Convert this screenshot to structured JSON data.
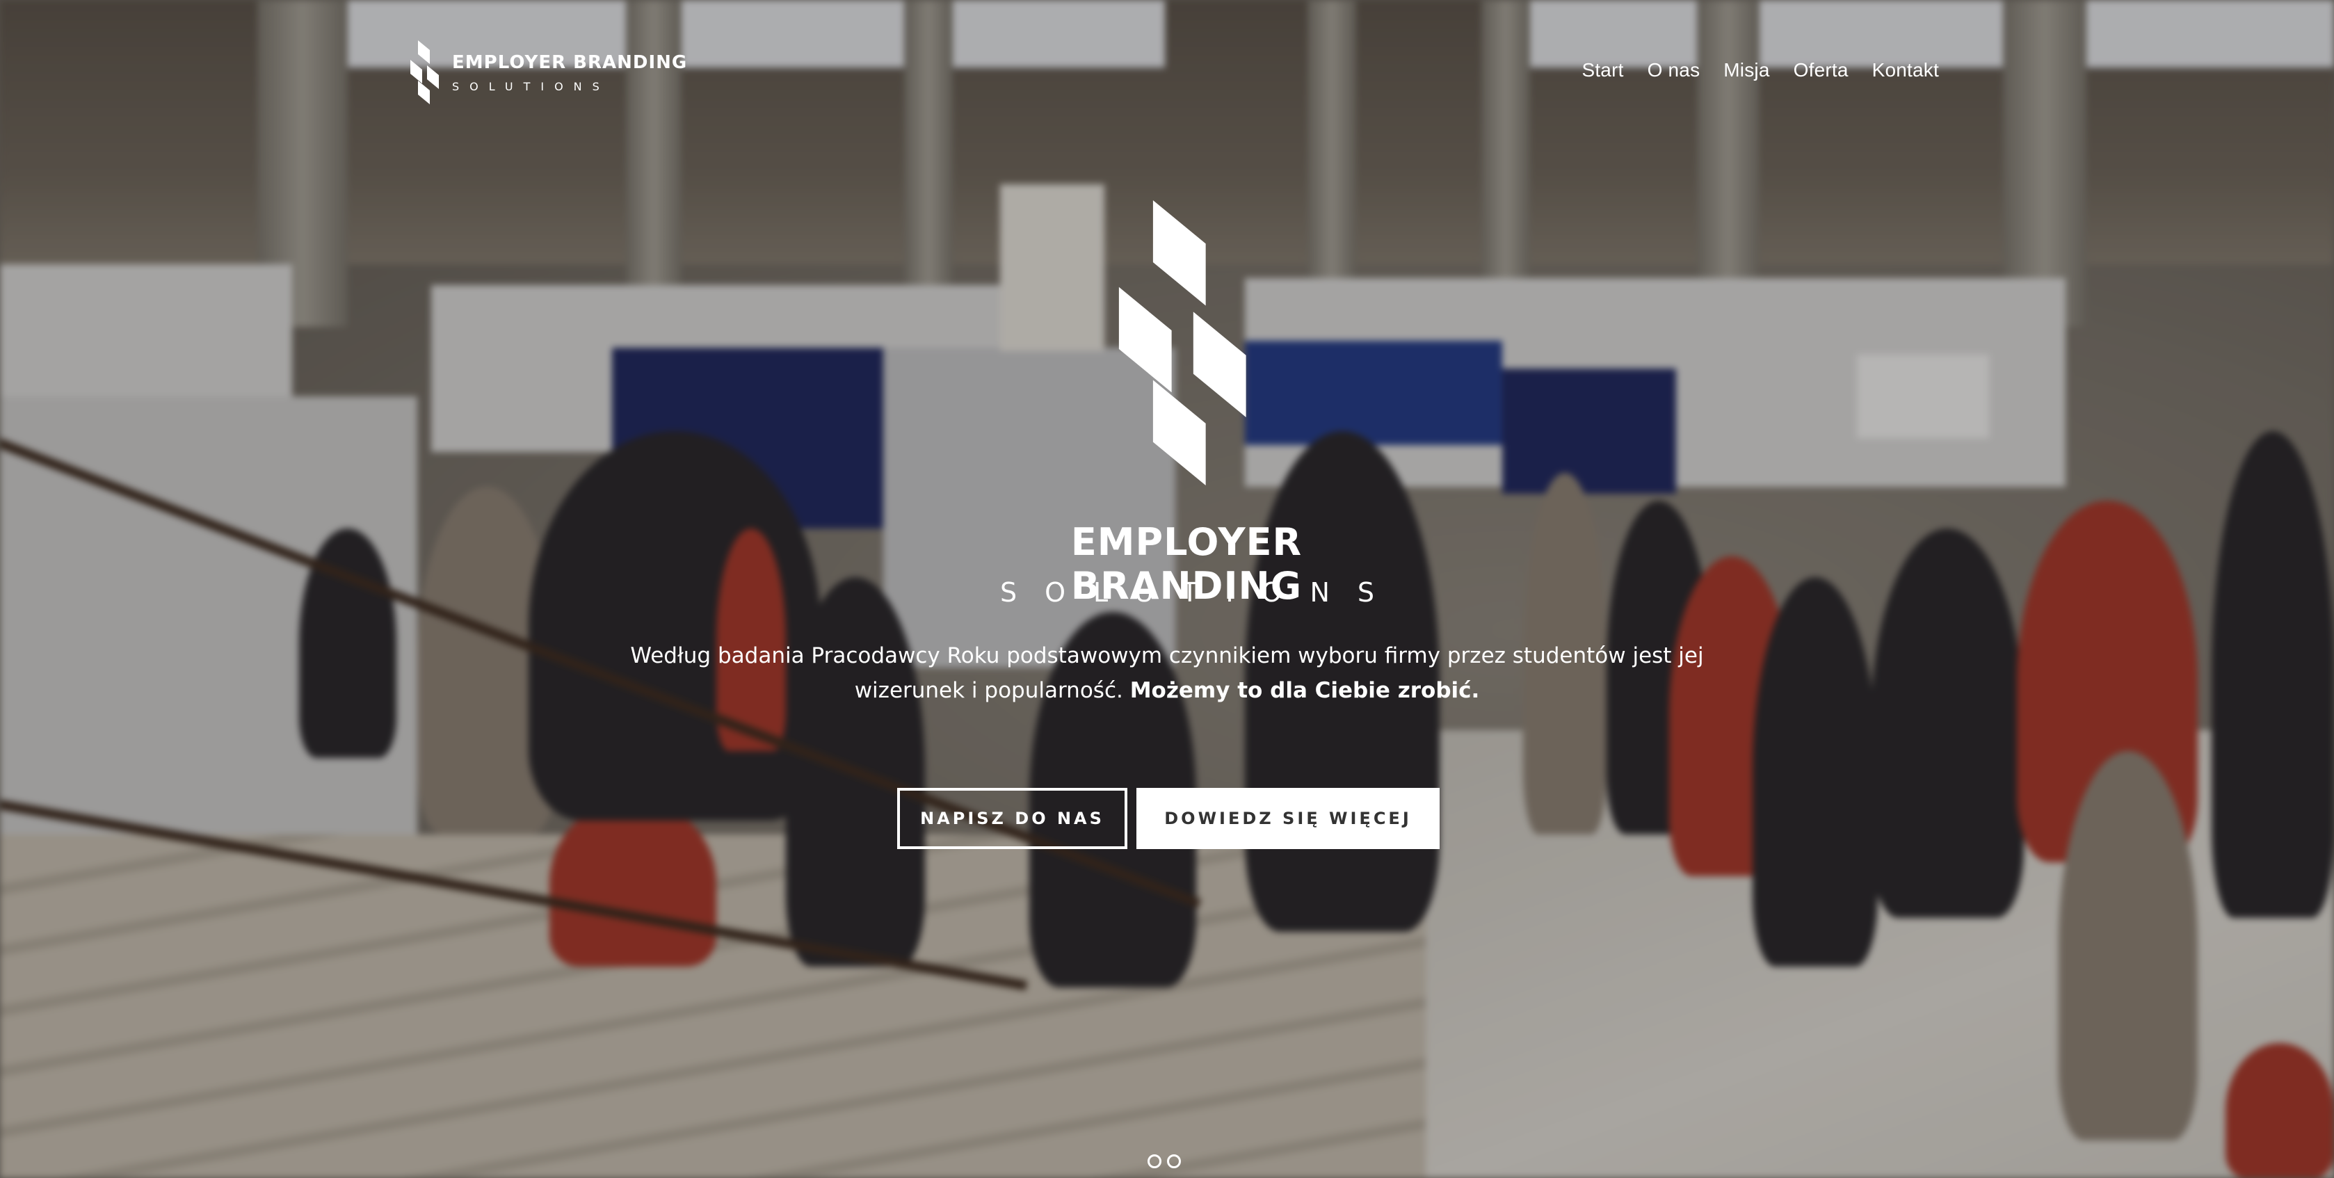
{
  "brand": {
    "title": "EMPLOYER BRANDING",
    "subtitle": "SOLUTIONS",
    "logo_icon": "eb-stacked-chevron-logo-icon"
  },
  "nav": {
    "items": [
      {
        "label": "Start"
      },
      {
        "label": "O nas"
      },
      {
        "label": "Misja"
      },
      {
        "label": "Oferta"
      },
      {
        "label": "Kontakt"
      }
    ]
  },
  "hero": {
    "title": "EMPLOYER BRANDING",
    "subtitle": "SOLUTIONS",
    "text_part1": "Według badania Pracodawcy Roku podstawowym czynnikiem wyboru firmy przez studentów jest jej wizerunek i popularność. ",
    "text_bold": "Możemy to dla Ciebie zrobić.",
    "button_primary": "NAPISZ DO NAS",
    "button_secondary": "DOWIEDZ SIĘ WIĘCEJ"
  },
  "slider": {
    "dots": 2
  },
  "colors": {
    "text": "#ffffff",
    "button_secondary_text": "#333333",
    "button_secondary_bg": "#ffffff"
  }
}
